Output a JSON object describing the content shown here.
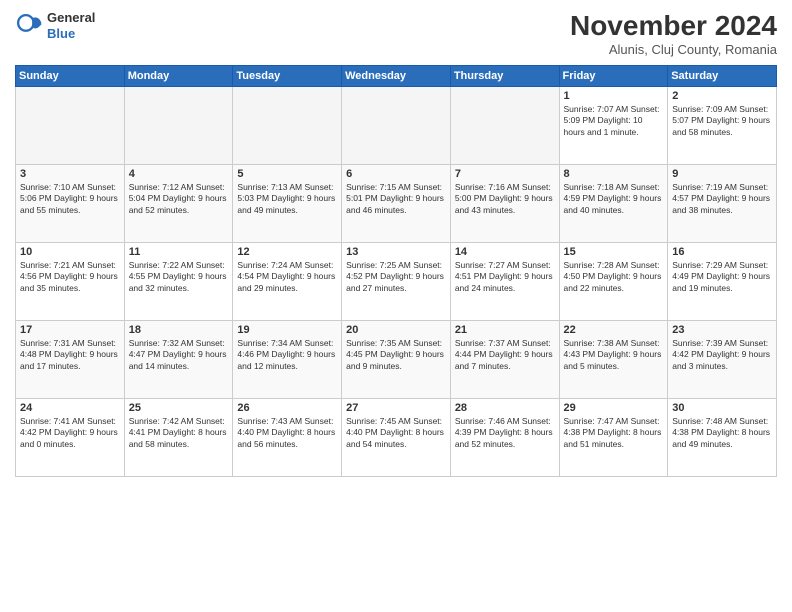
{
  "header": {
    "logo_general": "General",
    "logo_blue": "Blue",
    "month_title": "November 2024",
    "location": "Alunis, Cluj County, Romania"
  },
  "columns": [
    "Sunday",
    "Monday",
    "Tuesday",
    "Wednesday",
    "Thursday",
    "Friday",
    "Saturday"
  ],
  "weeks": [
    [
      {
        "day": "",
        "info": ""
      },
      {
        "day": "",
        "info": ""
      },
      {
        "day": "",
        "info": ""
      },
      {
        "day": "",
        "info": ""
      },
      {
        "day": "",
        "info": ""
      },
      {
        "day": "1",
        "info": "Sunrise: 7:07 AM\nSunset: 5:09 PM\nDaylight: 10 hours and 1 minute."
      },
      {
        "day": "2",
        "info": "Sunrise: 7:09 AM\nSunset: 5:07 PM\nDaylight: 9 hours and 58 minutes."
      }
    ],
    [
      {
        "day": "3",
        "info": "Sunrise: 7:10 AM\nSunset: 5:06 PM\nDaylight: 9 hours and 55 minutes."
      },
      {
        "day": "4",
        "info": "Sunrise: 7:12 AM\nSunset: 5:04 PM\nDaylight: 9 hours and 52 minutes."
      },
      {
        "day": "5",
        "info": "Sunrise: 7:13 AM\nSunset: 5:03 PM\nDaylight: 9 hours and 49 minutes."
      },
      {
        "day": "6",
        "info": "Sunrise: 7:15 AM\nSunset: 5:01 PM\nDaylight: 9 hours and 46 minutes."
      },
      {
        "day": "7",
        "info": "Sunrise: 7:16 AM\nSunset: 5:00 PM\nDaylight: 9 hours and 43 minutes."
      },
      {
        "day": "8",
        "info": "Sunrise: 7:18 AM\nSunset: 4:59 PM\nDaylight: 9 hours and 40 minutes."
      },
      {
        "day": "9",
        "info": "Sunrise: 7:19 AM\nSunset: 4:57 PM\nDaylight: 9 hours and 38 minutes."
      }
    ],
    [
      {
        "day": "10",
        "info": "Sunrise: 7:21 AM\nSunset: 4:56 PM\nDaylight: 9 hours and 35 minutes."
      },
      {
        "day": "11",
        "info": "Sunrise: 7:22 AM\nSunset: 4:55 PM\nDaylight: 9 hours and 32 minutes."
      },
      {
        "day": "12",
        "info": "Sunrise: 7:24 AM\nSunset: 4:54 PM\nDaylight: 9 hours and 29 minutes."
      },
      {
        "day": "13",
        "info": "Sunrise: 7:25 AM\nSunset: 4:52 PM\nDaylight: 9 hours and 27 minutes."
      },
      {
        "day": "14",
        "info": "Sunrise: 7:27 AM\nSunset: 4:51 PM\nDaylight: 9 hours and 24 minutes."
      },
      {
        "day": "15",
        "info": "Sunrise: 7:28 AM\nSunset: 4:50 PM\nDaylight: 9 hours and 22 minutes."
      },
      {
        "day": "16",
        "info": "Sunrise: 7:29 AM\nSunset: 4:49 PM\nDaylight: 9 hours and 19 minutes."
      }
    ],
    [
      {
        "day": "17",
        "info": "Sunrise: 7:31 AM\nSunset: 4:48 PM\nDaylight: 9 hours and 17 minutes."
      },
      {
        "day": "18",
        "info": "Sunrise: 7:32 AM\nSunset: 4:47 PM\nDaylight: 9 hours and 14 minutes."
      },
      {
        "day": "19",
        "info": "Sunrise: 7:34 AM\nSunset: 4:46 PM\nDaylight: 9 hours and 12 minutes."
      },
      {
        "day": "20",
        "info": "Sunrise: 7:35 AM\nSunset: 4:45 PM\nDaylight: 9 hours and 9 minutes."
      },
      {
        "day": "21",
        "info": "Sunrise: 7:37 AM\nSunset: 4:44 PM\nDaylight: 9 hours and 7 minutes."
      },
      {
        "day": "22",
        "info": "Sunrise: 7:38 AM\nSunset: 4:43 PM\nDaylight: 9 hours and 5 minutes."
      },
      {
        "day": "23",
        "info": "Sunrise: 7:39 AM\nSunset: 4:42 PM\nDaylight: 9 hours and 3 minutes."
      }
    ],
    [
      {
        "day": "24",
        "info": "Sunrise: 7:41 AM\nSunset: 4:42 PM\nDaylight: 9 hours and 0 minutes."
      },
      {
        "day": "25",
        "info": "Sunrise: 7:42 AM\nSunset: 4:41 PM\nDaylight: 8 hours and 58 minutes."
      },
      {
        "day": "26",
        "info": "Sunrise: 7:43 AM\nSunset: 4:40 PM\nDaylight: 8 hours and 56 minutes."
      },
      {
        "day": "27",
        "info": "Sunrise: 7:45 AM\nSunset: 4:40 PM\nDaylight: 8 hours and 54 minutes."
      },
      {
        "day": "28",
        "info": "Sunrise: 7:46 AM\nSunset: 4:39 PM\nDaylight: 8 hours and 52 minutes."
      },
      {
        "day": "29",
        "info": "Sunrise: 7:47 AM\nSunset: 4:38 PM\nDaylight: 8 hours and 51 minutes."
      },
      {
        "day": "30",
        "info": "Sunrise: 7:48 AM\nSunset: 4:38 PM\nDaylight: 8 hours and 49 minutes."
      }
    ]
  ]
}
